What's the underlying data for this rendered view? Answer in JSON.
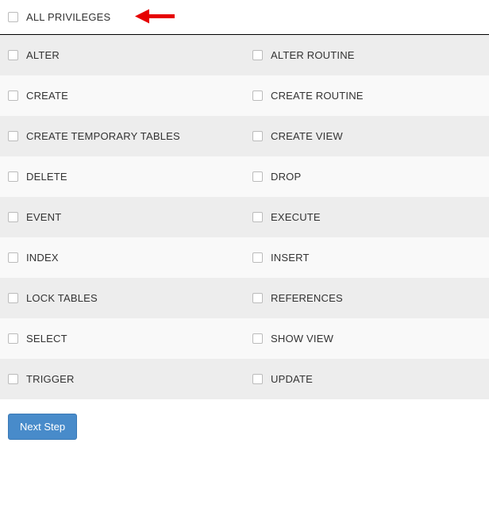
{
  "header": {
    "label": "ALL PRIVILEGES"
  },
  "privileges": [
    {
      "left": "ALTER",
      "right": "ALTER ROUTINE"
    },
    {
      "left": "CREATE",
      "right": "CREATE ROUTINE"
    },
    {
      "left": "CREATE TEMPORARY TABLES",
      "right": "CREATE VIEW"
    },
    {
      "left": "DELETE",
      "right": "DROP"
    },
    {
      "left": "EVENT",
      "right": "EXECUTE"
    },
    {
      "left": "INDEX",
      "right": "INSERT"
    },
    {
      "left": "LOCK TABLES",
      "right": "REFERENCES"
    },
    {
      "left": "SELECT",
      "right": "SHOW VIEW"
    },
    {
      "left": "TRIGGER",
      "right": "UPDATE"
    }
  ],
  "button": {
    "next_label": "Next Step"
  },
  "annotation": {
    "arrow_color": "#e60000"
  }
}
